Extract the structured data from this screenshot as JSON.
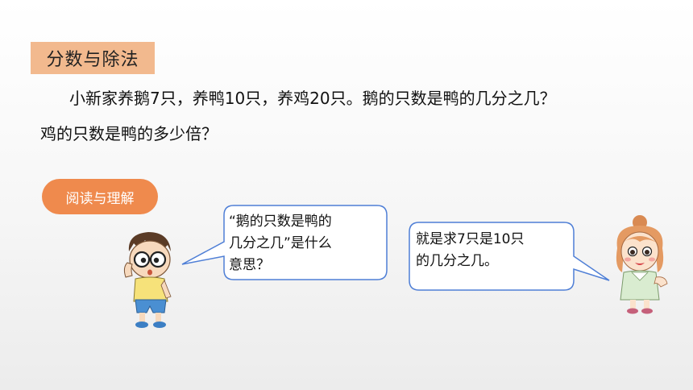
{
  "title_tag": "分数与除法",
  "problem": {
    "line1": "小新家养鹅7只，养鸭10只，养鸡20只。鹅的只数是鸭的几分之几？",
    "line2": "鸡的只数是鸭的多少倍？"
  },
  "read_tag": "阅读与理解",
  "bubble_left": {
    "line1": "“鹅的只数是鸭的",
    "line2": "几分之几”是什么",
    "line3": "意思？"
  },
  "bubble_right": {
    "line1": "就是求7只是10只",
    "line2": "的几分之几。"
  },
  "colors": {
    "title_bg": "#f2b98e",
    "read_tag_bg": "#ef8a4d",
    "bubble_border": "#4f7fd6"
  },
  "icons": {
    "boy": "boy-character",
    "girl": "girl-character"
  }
}
